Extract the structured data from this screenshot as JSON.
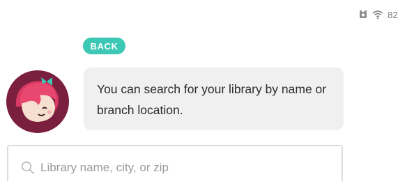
{
  "status_bar": {
    "battery_text": "82",
    "icons": [
      "alarm-icon",
      "wifi-icon"
    ]
  },
  "back_button": {
    "label": "BACK",
    "color": "#3cc8b4"
  },
  "assistant": {
    "avatar": "libby-avatar",
    "message": "You can search for your library by name or branch location."
  },
  "search": {
    "value": "",
    "placeholder": "Library name, city, or zip",
    "icon": "search-icon"
  },
  "colors": {
    "accent": "#3cc8b4",
    "avatar_bg": "#7a1f3d",
    "bubble_bg": "#f0f0f0"
  }
}
